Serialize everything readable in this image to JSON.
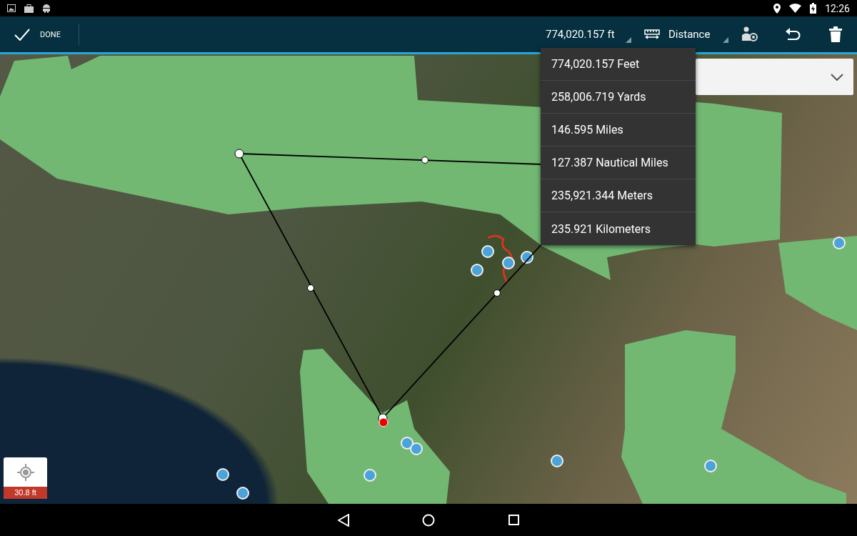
{
  "status_bar": {
    "time": "12:26"
  },
  "toolbar": {
    "done_label": "DONE",
    "measurement": "774,020.157 ft",
    "mode": "Distance"
  },
  "unit_menu": {
    "items": [
      {
        "label": "774,020.157 Feet"
      },
      {
        "label": "258,006.719 Yards"
      },
      {
        "label": "146.595 Miles"
      },
      {
        "label": "127.387 Nautical Miles"
      },
      {
        "label": "235,921.344 Meters"
      },
      {
        "label": "235.921 Kilometers"
      }
    ]
  },
  "location_button": {
    "scale": "30.8 ft"
  }
}
